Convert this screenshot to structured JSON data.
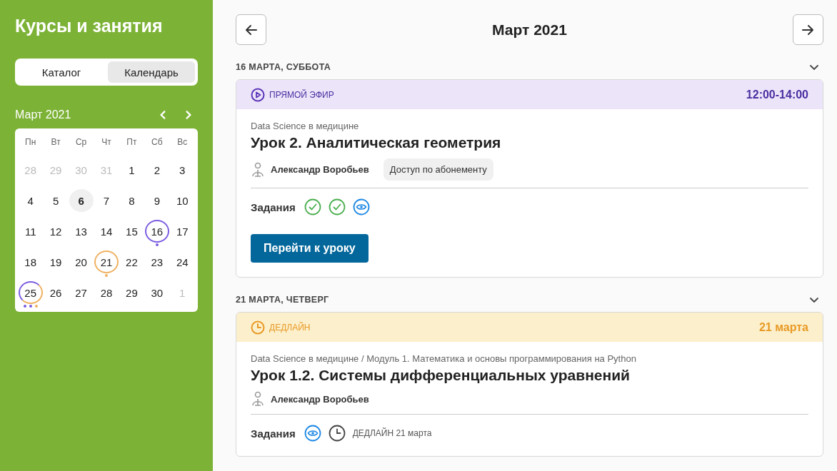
{
  "sidebar": {
    "title": "Курсы и занятия",
    "tabs": [
      {
        "label": "Каталог",
        "selected": false
      },
      {
        "label": "Календарь",
        "selected": true
      }
    ],
    "calendar": {
      "month": "Март 2021",
      "weekdays": [
        "Пн",
        "Вт",
        "Ср",
        "Чт",
        "Пт",
        "Сб",
        "Вс"
      ],
      "days": [
        {
          "day": "28",
          "kind": "outside"
        },
        {
          "day": "29",
          "kind": "outside"
        },
        {
          "day": "30",
          "kind": "outside"
        },
        {
          "day": "31",
          "kind": "outside"
        },
        {
          "day": "1",
          "kind": "day"
        },
        {
          "day": "2",
          "kind": "day"
        },
        {
          "day": "3",
          "kind": "day"
        },
        {
          "day": "4",
          "kind": "day"
        },
        {
          "day": "5",
          "kind": "day"
        },
        {
          "day": "6",
          "kind": "today"
        },
        {
          "day": "7",
          "kind": "day"
        },
        {
          "day": "8",
          "kind": "day"
        },
        {
          "day": "9",
          "kind": "day"
        },
        {
          "day": "10",
          "kind": "day"
        },
        {
          "day": "11",
          "kind": "day"
        },
        {
          "day": "12",
          "kind": "day"
        },
        {
          "day": "13",
          "kind": "day"
        },
        {
          "day": "14",
          "kind": "day"
        },
        {
          "day": "15",
          "kind": "day"
        },
        {
          "day": "16",
          "kind": "day",
          "events": [
            {
              "color": "#7b5ce0"
            }
          ]
        },
        {
          "day": "17",
          "kind": "day"
        },
        {
          "day": "18",
          "kind": "day"
        },
        {
          "day": "19",
          "kind": "day"
        },
        {
          "day": "20",
          "kind": "day"
        },
        {
          "day": "21",
          "kind": "day",
          "events": [
            {
              "color": "#f0b060"
            }
          ]
        },
        {
          "day": "22",
          "kind": "day"
        },
        {
          "day": "23",
          "kind": "day"
        },
        {
          "day": "24",
          "kind": "day"
        },
        {
          "day": "25",
          "kind": "day",
          "events": [
            {
              "color": "#7b5ce0"
            },
            {
              "color": "#7b5ce0"
            },
            {
              "color": "#f0b060"
            }
          ]
        },
        {
          "day": "26",
          "kind": "day"
        },
        {
          "day": "27",
          "kind": "day"
        },
        {
          "day": "28",
          "kind": "day"
        },
        {
          "day": "29",
          "kind": "day"
        },
        {
          "day": "30",
          "kind": "day"
        },
        {
          "day": "1",
          "kind": "outside"
        }
      ]
    }
  },
  "main": {
    "title": "Март 2021",
    "sections": [
      {
        "date": "16 МАРТА, СУББОТА",
        "cards": [
          {
            "kind": "live",
            "badge": "ПРЯМОЙ ЭФИР",
            "time": "12:00-14:00",
            "course": "Data Science в медицине",
            "title": "Урок 2. Аналитическая геометрия",
            "author": "Александр Воробьев",
            "tag": "Доступ по абонементу",
            "tasks_label": "Задания",
            "tasks": [
              {
                "kind": "done"
              },
              {
                "kind": "done"
              },
              {
                "kind": "viewed"
              }
            ],
            "button": "Перейти к уроку"
          }
        ]
      },
      {
        "date": "21 МАРТА, ЧЕТВЕРГ",
        "cards": [
          {
            "kind": "deadline",
            "badge": "ДЕДЛАЙН",
            "time": "21 марта",
            "course": "Data Science в медицине / Модуль 1. Математика и основы программирования на Python",
            "title": "Урок 1.2. Системы дифференциальных уравнений",
            "author": "Александр Воробьев",
            "tasks_label": "Задания",
            "tasks": [
              {
                "kind": "viewed"
              },
              {
                "kind": "deadline",
                "text": "ДЕДЛАЙН 21 марта"
              }
            ]
          }
        ]
      }
    ]
  }
}
